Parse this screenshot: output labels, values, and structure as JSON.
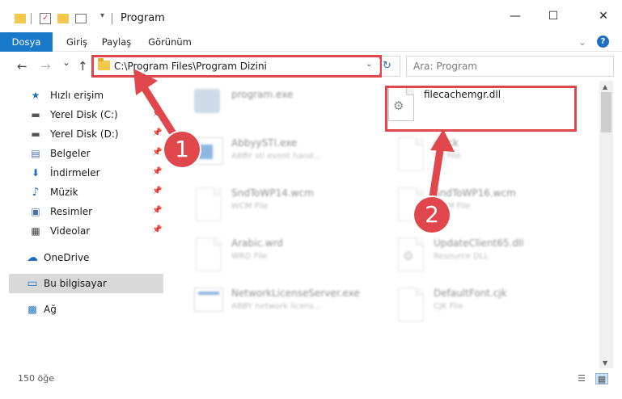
{
  "window": {
    "title": "Program",
    "minimize_glyph": "—",
    "maximize_glyph": "☐",
    "close_glyph": "✕"
  },
  "ribbon": {
    "tabs": [
      {
        "label": "Dosya",
        "active": true
      },
      {
        "label": "Giriş",
        "active": false
      },
      {
        "label": "Paylaş",
        "active": false
      },
      {
        "label": "Görünüm",
        "active": false
      }
    ],
    "collapse_glyph": "⌄",
    "help_glyph": "?"
  },
  "nav": {
    "back_glyph": "←",
    "forward_glyph": "→",
    "recent_glyph": "⌄",
    "up_glyph": "↑",
    "address": "C:\\Program Files\\Program Dizini",
    "address_dropdown_glyph": "⌄",
    "refresh_glyph": "↻",
    "search_placeholder": "Ara: Program"
  },
  "sidebar": {
    "items": [
      {
        "label": "Hızlı erişim",
        "icon": "star-icon",
        "glyph": "★",
        "color": "#1f6fc0",
        "pinned": false
      },
      {
        "label": "Yerel Disk (C:)",
        "icon": "drive-icon",
        "glyph": "▬",
        "color": "#555555",
        "pinned": true
      },
      {
        "label": "Yerel Disk (D:)",
        "icon": "drive-icon",
        "glyph": "▬",
        "color": "#555555",
        "pinned": true
      },
      {
        "label": "Belgeler",
        "icon": "documents-icon",
        "glyph": "▤",
        "color": "#4a6fa5",
        "pinned": true
      },
      {
        "label": "İndirmeler",
        "icon": "download-icon",
        "glyph": "⬇",
        "color": "#1f6fc0",
        "pinned": true
      },
      {
        "label": "Müzik",
        "icon": "music-icon",
        "glyph": "♪",
        "color": "#1f6fc0",
        "pinned": true
      },
      {
        "label": "Resimler",
        "icon": "pictures-icon",
        "glyph": "▣",
        "color": "#4a6fa5",
        "pinned": true
      },
      {
        "label": "Videolar",
        "icon": "videos-icon",
        "glyph": "▦",
        "color": "#444444",
        "pinned": true
      },
      {
        "label": "OneDrive",
        "icon": "cloud-icon",
        "glyph": "☁",
        "color": "#1f6fc0",
        "pinned": false
      },
      {
        "label": "Bu bilgisayar",
        "icon": "computer-icon",
        "glyph": "▭",
        "color": "#1f6fc0",
        "pinned": false,
        "selected": true
      },
      {
        "label": "Ağ",
        "icon": "network-icon",
        "glyph": "▩",
        "color": "#1f6fc0",
        "pinned": false
      }
    ],
    "pin_glyph": "📌"
  },
  "files": [
    {
      "name": "program.exe",
      "type": "",
      "highlighted": false
    },
    {
      "name": "filecachemgr.dll",
      "type": "",
      "highlighted": true
    },
    {
      "name": "AbbyySTI.exe",
      "type": "ABBY sti event hand...",
      "highlighted": false
    },
    {
      "name": "ck.ck",
      "type": "CK File",
      "highlighted": false
    },
    {
      "name": "SndToWP14.wcm",
      "type": "WCM File",
      "highlighted": false
    },
    {
      "name": "SndToWP16.wcm",
      "type": "WCM File",
      "highlighted": false
    },
    {
      "name": "Arabic.wrd",
      "type": "WRD File",
      "highlighted": false
    },
    {
      "name": "UpdateClient65.dll",
      "type": "Resource DLL",
      "highlighted": false
    },
    {
      "name": "NetworkLicenseServer.exe",
      "type": "ABBY network licens...",
      "highlighted": false
    },
    {
      "name": "DefaultFont.cjk",
      "type": "CJK File",
      "highlighted": false
    }
  ],
  "status": {
    "item_count": "150 öğe"
  },
  "markers": [
    {
      "label": "1"
    },
    {
      "label": "2"
    }
  ],
  "colors": {
    "accent": "#1979ca",
    "highlight": "#e0474c",
    "folder": "#f3c84b"
  }
}
